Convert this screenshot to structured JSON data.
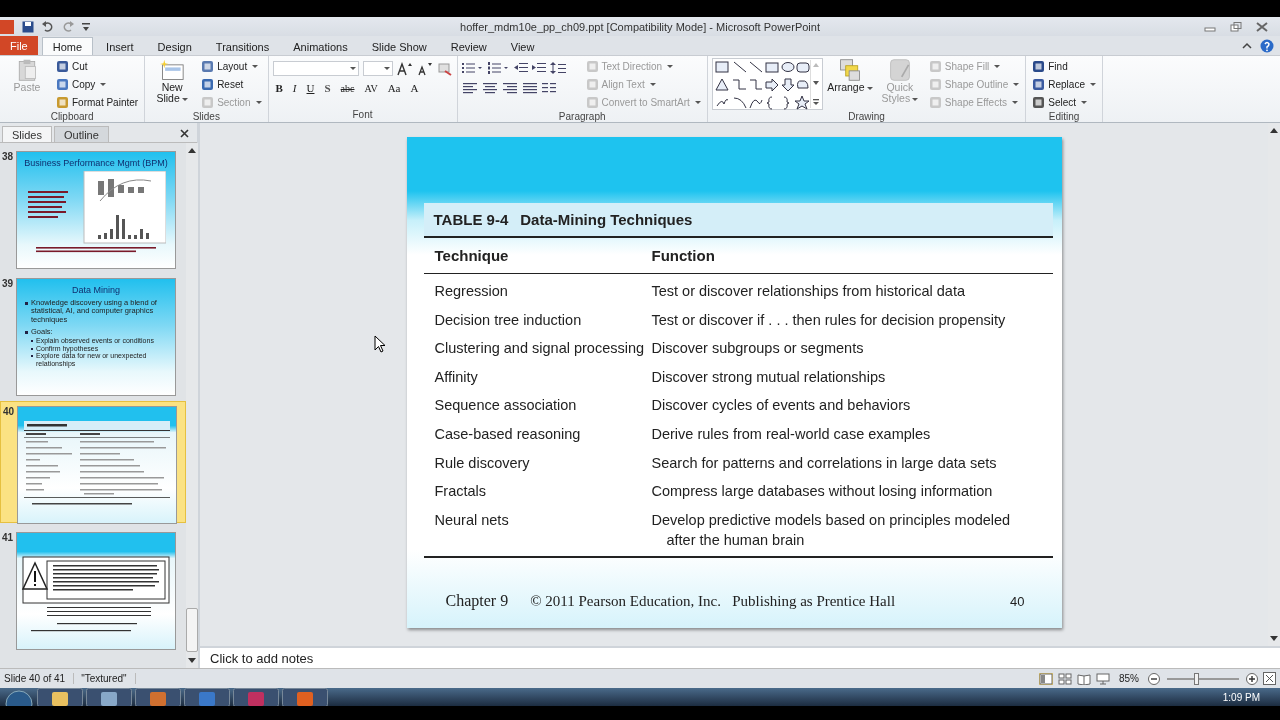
{
  "window": {
    "title": "hoffer_mdm10e_pp_ch09.ppt [Compatibility Mode] - Microsoft PowerPoint"
  },
  "tabs": [
    {
      "label": "File",
      "kind": "file",
      "selected": false
    },
    {
      "label": "Home",
      "kind": "tab",
      "selected": true
    },
    {
      "label": "Insert",
      "kind": "tab",
      "selected": false
    },
    {
      "label": "Design",
      "kind": "tab",
      "selected": false
    },
    {
      "label": "Transitions",
      "kind": "tab",
      "selected": false
    },
    {
      "label": "Animations",
      "kind": "tab",
      "selected": false
    },
    {
      "label": "Slide Show",
      "kind": "tab",
      "selected": false
    },
    {
      "label": "Review",
      "kind": "tab",
      "selected": false
    },
    {
      "label": "View",
      "kind": "tab",
      "selected": false
    }
  ],
  "ribbon": [
    {
      "kind": "clipboard",
      "label": "Clipboard",
      "big": [
        {
          "label": "Paste",
          "disabled": true,
          "dropdown": false
        }
      ],
      "small": [
        {
          "label": "Cut",
          "disabled": false,
          "dropdown": false
        },
        {
          "label": "Copy",
          "disabled": false,
          "dropdown": true
        },
        {
          "label": "Format Painter",
          "disabled": false,
          "dropdown": false
        }
      ]
    },
    {
      "kind": "slides",
      "label": "Slides",
      "big": [
        {
          "label": "New Slide",
          "disabled": false,
          "dropdown": true
        }
      ],
      "small": [
        {
          "label": "Layout",
          "disabled": false,
          "dropdown": true
        },
        {
          "label": "Reset",
          "disabled": false,
          "dropdown": false
        },
        {
          "label": "Section",
          "disabled": true,
          "dropdown": true
        }
      ]
    },
    {
      "kind": "font",
      "label": "Font",
      "buttons": [
        "B",
        "I",
        "U",
        "S",
        "abc",
        "AV",
        "Aa",
        "A"
      ]
    },
    {
      "kind": "paragraph",
      "label": "Paragraph",
      "small": [
        {
          "label": "Text Direction",
          "disabled": true,
          "dropdown": true
        },
        {
          "label": "Align Text",
          "disabled": true,
          "dropdown": true
        },
        {
          "label": "Convert to SmartArt",
          "disabled": true,
          "dropdown": true
        }
      ]
    },
    {
      "kind": "drawing",
      "label": "Drawing",
      "big": [
        {
          "label": "Arrange",
          "disabled": false,
          "dropdown": true
        },
        {
          "label": "Quick Styles",
          "disabled": true,
          "dropdown": true
        }
      ],
      "small": [
        {
          "label": "Shape Fill",
          "disabled": true,
          "dropdown": true
        },
        {
          "label": "Shape Outline",
          "disabled": true,
          "dropdown": true
        },
        {
          "label": "Shape Effects",
          "disabled": true,
          "dropdown": true
        }
      ]
    },
    {
      "kind": "editing",
      "label": "Editing",
      "small": [
        {
          "label": "Find",
          "disabled": false,
          "dropdown": false
        },
        {
          "label": "Replace",
          "disabled": false,
          "dropdown": true
        },
        {
          "label": "Select",
          "disabled": false,
          "dropdown": true
        }
      ]
    }
  ],
  "pane_tabs": [
    {
      "label": "Slides",
      "selected": true
    },
    {
      "label": "Outline",
      "selected": false
    }
  ],
  "thumbnails": [
    {
      "number": "38",
      "kind": "chart",
      "selected": false,
      "title": "Business Performance Mgmt (BPM)"
    },
    {
      "number": "39",
      "kind": "bullets",
      "selected": false,
      "title": "Data Mining",
      "bullets": [
        {
          "text": "Knowledge discovery using a blend of statistical, AI, and computer graphics techniques"
        },
        {
          "text": "Goals:",
          "children": [
            {
              "text": "Explain observed events or conditions"
            },
            {
              "text": "Confirm hypotheses"
            },
            {
              "text": "Explore data for new or unexpected relationships"
            }
          ]
        }
      ]
    },
    {
      "number": "40",
      "kind": "table",
      "selected": true
    },
    {
      "number": "41",
      "kind": "notice",
      "selected": false
    }
  ],
  "slide": {
    "table_number": "TABLE 9-4",
    "table_title": "Data-Mining Techniques",
    "columns": [
      "Technique",
      "Function"
    ],
    "rows": [
      [
        "Regression",
        "Test or discover relationships from historical data"
      ],
      [
        "Decision tree induction",
        "Test or discover if . . . then rules for decision propensity"
      ],
      [
        "Clustering and signal processing",
        "Discover subgroups or segments"
      ],
      [
        "Affinity",
        "Discover strong mutual relationships"
      ],
      [
        "Sequence association",
        "Discover cycles of events and behaviors"
      ],
      [
        "Case-based reasoning",
        "Derive rules from real-world case examples"
      ],
      [
        "Rule discovery",
        "Search for patterns and correlations in large data sets"
      ],
      [
        "Fractals",
        "Compress large databases without losing information"
      ],
      [
        "Neural nets",
        "Develop predictive models based on principles modeled after the human brain"
      ]
    ],
    "chapter": "Chapter 9",
    "copyright": "© 2011 Pearson Education, Inc.   Publishing as Prentice Hall",
    "page": "40"
  },
  "notes": {
    "placeholder": "Click to add notes"
  },
  "status_bar": {
    "slide": "Slide 40 of 41",
    "theme": "\"Textured\"",
    "zoom": "85%",
    "zoom_slider": {
      "level": 0.4
    }
  },
  "taskbar": {
    "time": "1:09 PM"
  }
}
